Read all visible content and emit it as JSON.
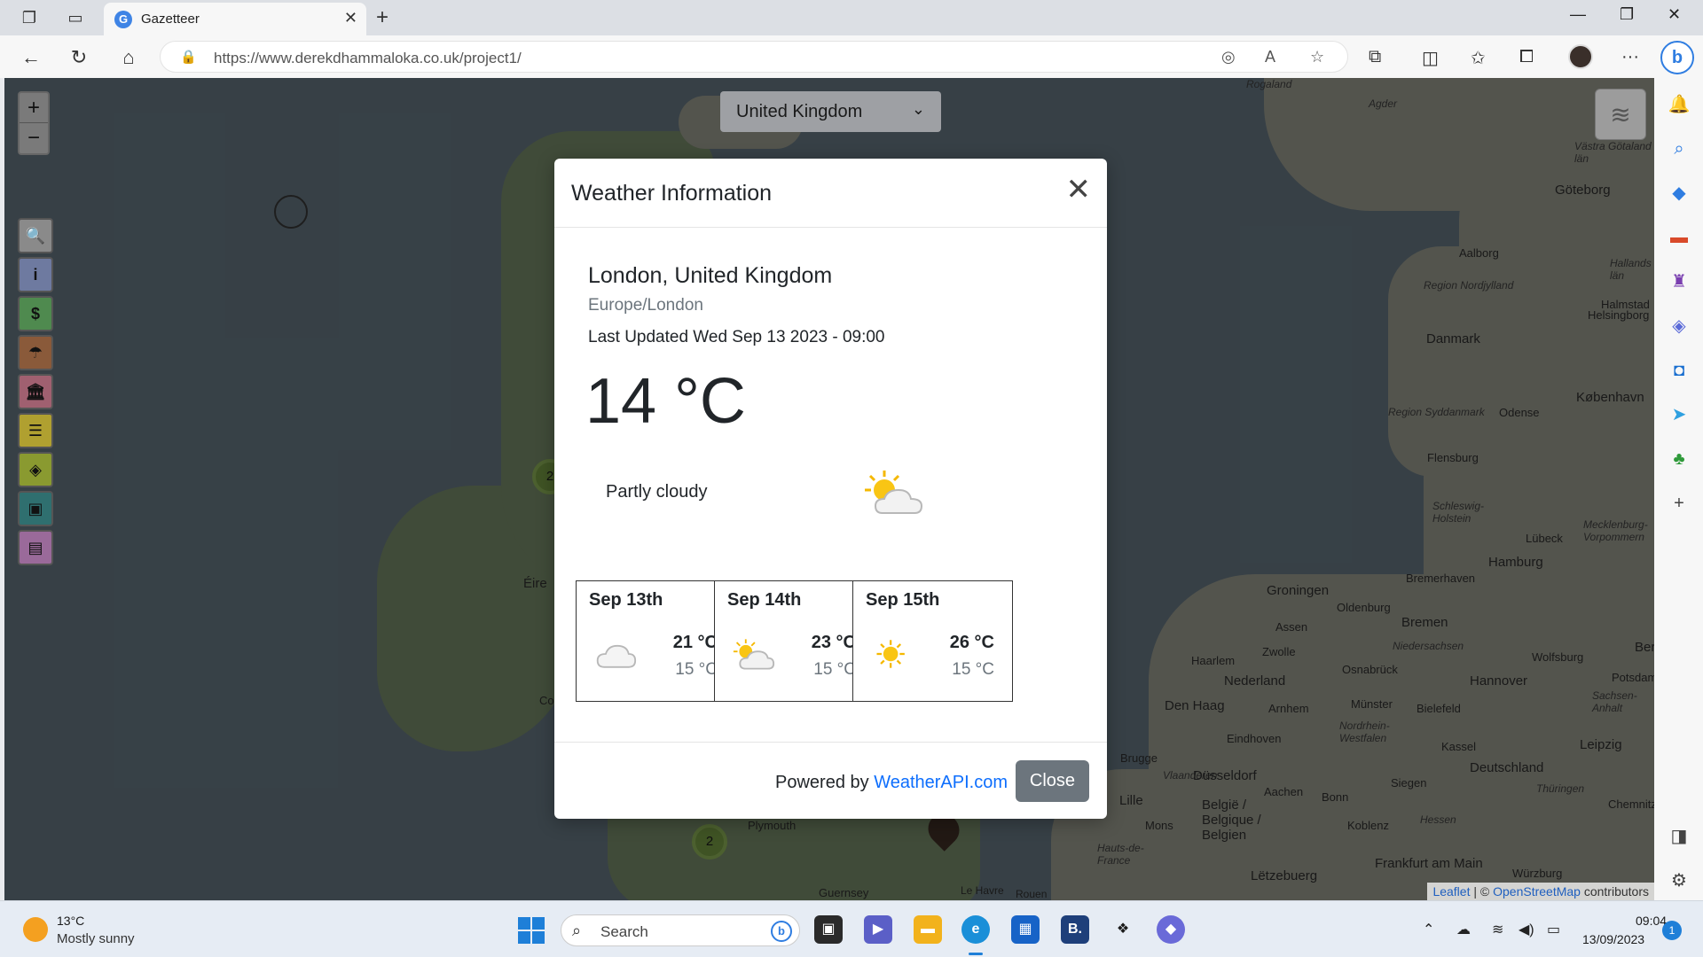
{
  "browser": {
    "tab_title": "Gazetteer",
    "tab_favicon_letter": "G",
    "url": "https://www.derekdhammaloka.co.uk/project1/"
  },
  "map": {
    "country_select": "United Kingdom",
    "zoom_in": "+",
    "zoom_out": "−",
    "side_buttons": [
      {
        "icon": "search-icon",
        "glyph": "🔍",
        "color": "#8a8a8a"
      },
      {
        "icon": "info-icon",
        "glyph": "i",
        "color": "#6e7aa0"
      },
      {
        "icon": "currency-icon",
        "glyph": "$",
        "color": "#4f8a4f"
      },
      {
        "icon": "umbrella-icon",
        "glyph": "☂",
        "color": "#8a5a3a"
      },
      {
        "icon": "bank-icon",
        "glyph": "🏛",
        "color": "#a06070"
      },
      {
        "icon": "database-icon",
        "glyph": "☰",
        "color": "#b0a030"
      },
      {
        "icon": "locate-icon",
        "glyph": "◈",
        "color": "#8a9a30"
      },
      {
        "icon": "id-card-icon",
        "glyph": "▣",
        "color": "#2f6f6f"
      },
      {
        "icon": "news-icon",
        "glyph": "▤",
        "color": "#9a6a9a"
      }
    ],
    "clusters": [
      "2",
      "2"
    ],
    "labels": {
      "rogaland": "Rogaland",
      "agder": "Agder",
      "vastra": "Västra Götaland län",
      "goteborg": "Göteborg",
      "aalborg": "Aalborg",
      "nordjylland": "Region Nordjylland",
      "hallands": "Hallands län",
      "halmstad": "Halmstad",
      "danmark": "Danmark",
      "helsingborg": "Helsingborg",
      "kobenhavn": "København",
      "syddanmark": "Region Syddanmark",
      "odense": "Odense",
      "flensburg": "Flensburg",
      "schleswig": "Schleswig-Holstein",
      "lubeck": "Lübeck",
      "mecklenburg": "Mecklenburg-Vorpommern",
      "hamburg": "Hamburg",
      "bremerhaven": "Bremerhaven",
      "groningen": "Groningen",
      "oldenburg": "Oldenburg",
      "bremen": "Bremen",
      "assen": "Assen",
      "niedersachsen": "Niedersachsen",
      "zwolle": "Zwolle",
      "haarlem": "Haarlem",
      "nederland": "Nederland",
      "osnabruck": "Osnabrück",
      "hannover": "Hannover",
      "wolfsburg": "Wolfsburg",
      "potsdam": "Potsdam",
      "ber": "Ber",
      "sachsen_anhalt": "Sachsen-Anhalt",
      "denhaag": "Den Haag",
      "arnhem": "Arnhem",
      "munster": "Münster",
      "bielefeld": "Bielefeld",
      "nordrhein": "Nordrhein-Westfalen",
      "eindhoven": "Eindhoven",
      "kassel": "Kassel",
      "leipzig": "Leipzig",
      "vlaanderen": "Vlaanderen",
      "dusseldorf": "Düsseldorf",
      "deutschland": "Deutschland",
      "brugge": "Brugge",
      "siegen": "Siegen",
      "thuringen": "Thüringen",
      "lille": "Lille",
      "aachen": "Aachen",
      "bonn": "Bonn",
      "belgie": "België / Belgique / Belgien",
      "hessen": "Hessen",
      "chemnitz": "Chemnitz",
      "mons": "Mons",
      "koblenz": "Koblenz",
      "hauts": "Hauts-de-France",
      "frankfurt": "Frankfurt am Main",
      "letzebuerg": "Lëtzebuerg",
      "wurzburg": "Würzburg",
      "eire": "Éire",
      "co": "Co",
      "plymouth": "Plymouth",
      "guernsey": "Guernsey",
      "lehavre": "Le Havre",
      "rouen": "Rouen"
    },
    "attribution": {
      "leaflet": "Leaflet",
      "sep": " | © ",
      "osm": "OpenStreetMap",
      "contrib": " contributors"
    }
  },
  "modal": {
    "title": "Weather Information",
    "location": "London, United Kingdom",
    "timezone": "Europe/London",
    "last_updated": "Last Updated Wed Sep 13 2023 - 09:00",
    "temperature": "14 °C",
    "condition": "Partly cloudy",
    "forecast": [
      {
        "date": "Sep 13th",
        "max": "21 °C",
        "min": "15 °C",
        "icon": "cloud-icon"
      },
      {
        "date": "Sep 14th",
        "max": "23 °C",
        "min": "15 °C",
        "icon": "partly-cloudy-icon"
      },
      {
        "date": "Sep 15th",
        "max": "26 °C",
        "min": "15 °C",
        "icon": "sun-icon"
      }
    ],
    "powered_by": "Powered by ",
    "powered_link": "WeatherAPI.com",
    "close_label": "Close"
  },
  "taskbar": {
    "weather_temp": "13°C",
    "weather_cond": "Mostly sunny",
    "search_placeholder": "Search",
    "time": "09:04",
    "date": "13/09/2023",
    "notification_count": "1"
  }
}
